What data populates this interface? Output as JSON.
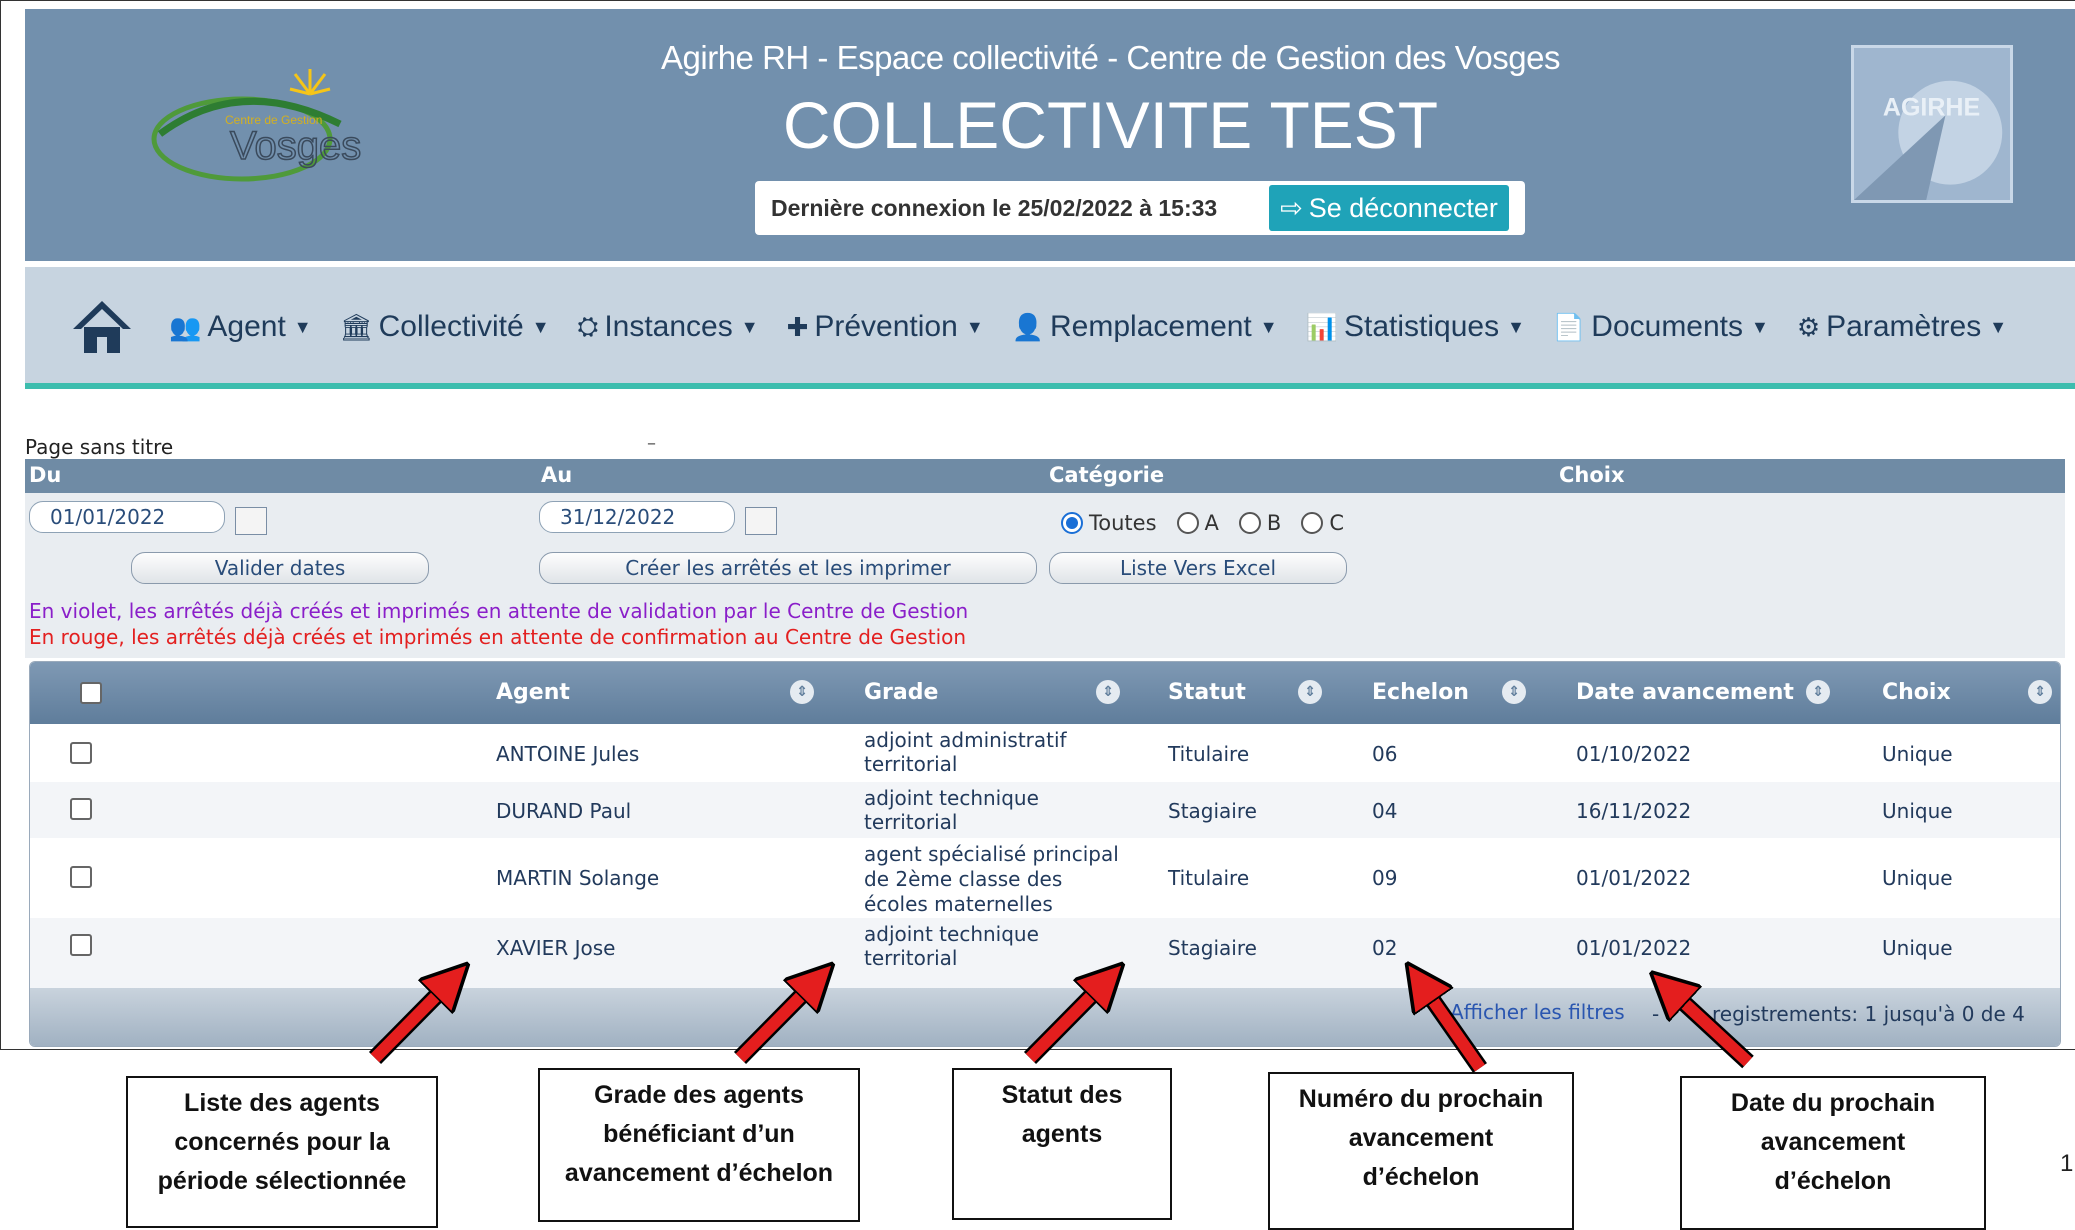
{
  "header": {
    "site_title": "Agirhe RH - Espace collectivité - Centre de Gestion des Vosges",
    "collectivity": "COLLECTIVITE TEST",
    "last_connection": "Dernière connexion le 25/02/2022 à 15:33",
    "logout_label": "Se déconnecter",
    "logo_text": "Vosges",
    "logo_subtext": "Centre de Gestion",
    "agirhe_text": "AGIRHE"
  },
  "nav": {
    "items": [
      {
        "label": "Agent",
        "icon": "users-icon"
      },
      {
        "label": "Collectivité",
        "icon": "bank-icon"
      },
      {
        "label": "Instances",
        "icon": "meeting-icon"
      },
      {
        "label": "Prévention",
        "icon": "medkit-icon"
      },
      {
        "label": "Remplacement",
        "icon": "user-clock-icon"
      },
      {
        "label": "Statistiques",
        "icon": "chart-icon"
      },
      {
        "label": "Documents",
        "icon": "file-icon"
      },
      {
        "label": "Paramètres",
        "icon": "cogs-icon"
      }
    ]
  },
  "page": {
    "title": "Page sans titre",
    "dash": "–"
  },
  "filters": {
    "headers": {
      "du": "Du",
      "au": "Au",
      "categorie": "Catégorie",
      "choix": "Choix"
    },
    "date_from": "01/01/2022",
    "date_to": "31/12/2022",
    "radios": [
      "Toutes",
      "A",
      "B",
      "C"
    ],
    "selected_radio": "Toutes",
    "btn_validate": "Valider dates",
    "btn_create": "Créer les arrêtés et les imprimer",
    "btn_excel": "Liste Vers Excel"
  },
  "legend": {
    "violet": "En violet, les arrêtés déjà créés et imprimés en attente de validation par le Centre de Gestion",
    "red": "En rouge, les arrêtés déjà créés et imprimés en attente de confirmation au Centre de Gestion"
  },
  "table": {
    "columns": [
      "Agent",
      "Grade",
      "Statut",
      "Echelon",
      "Date avancement",
      "Choix"
    ],
    "rows": [
      {
        "agent": "ANTOINE Jules",
        "grade": [
          "adjoint administratif",
          "territorial"
        ],
        "statut": "Titulaire",
        "echelon": "06",
        "date": "01/10/2022",
        "choix": "Unique"
      },
      {
        "agent": "DURAND Paul",
        "grade": [
          "adjoint technique",
          "territorial"
        ],
        "statut": "Stagiaire",
        "echelon": "04",
        "date": "16/11/2022",
        "choix": "Unique"
      },
      {
        "agent": "MARTIN Solange",
        "grade": [
          "agent spécialisé principal",
          "de 2ème classe des",
          "écoles maternelles"
        ],
        "statut": "Titulaire",
        "echelon": "09",
        "date": "01/01/2022",
        "choix": "Unique"
      },
      {
        "agent": "XAVIER Jose",
        "grade": [
          "adjoint technique",
          "territorial"
        ],
        "statut": "Stagiaire",
        "echelon": "02",
        "date": "01/01/2022",
        "choix": "Unique"
      }
    ],
    "footer_link": "Afficher les filtres",
    "footer_sep": "-",
    "footer_records": "registrements: 1 jusqu'à 0 de 4"
  },
  "callouts": [
    [
      "Liste des agents",
      "concernés pour la",
      "période sélectionnée"
    ],
    [
      "Grade des agents",
      "bénéficiant d’un",
      "avancement d’échelon"
    ],
    [
      "Statut des",
      "agents"
    ],
    [
      "Numéro du prochain",
      "avancement",
      "d’échelon"
    ],
    [
      "Date du prochain",
      "avancement",
      "d’échelon"
    ]
  ],
  "page_number": "1",
  "colors": {
    "header_bg": "#7290ad",
    "nav_bg": "#c7d4e0",
    "accent": "#3dbdae",
    "logout_bg": "#1fa3b8",
    "violet": "#8a1fc9",
    "red": "#e32020"
  }
}
